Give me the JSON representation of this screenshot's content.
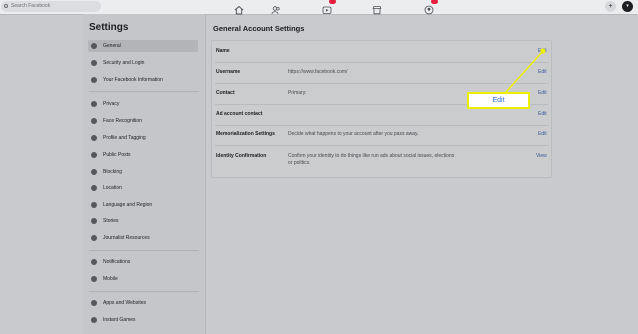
{
  "topbar": {
    "search_placeholder": "Search Facebook",
    "nav_icons": [
      "home-icon",
      "friends-icon",
      "watch-icon",
      "marketplace-icon",
      "groups-icon"
    ],
    "right_buttons": {
      "create": "+",
      "account": "▾"
    }
  },
  "sidebar": {
    "title": "Settings",
    "groups": [
      [
        {
          "label": "General",
          "icon": "gear-icon",
          "active": true
        },
        {
          "label": "Security and Login",
          "icon": "shield-icon"
        },
        {
          "label": "Your Facebook Information",
          "icon": "facebook-icon"
        }
      ],
      [
        {
          "label": "Privacy",
          "icon": "lock-icon"
        },
        {
          "label": "Face Recognition",
          "icon": "face-icon"
        },
        {
          "label": "Profile and Tagging",
          "icon": "tag-icon"
        },
        {
          "label": "Public Posts",
          "icon": "globe-icon"
        },
        {
          "label": "Blocking",
          "icon": "block-icon"
        },
        {
          "label": "Location",
          "icon": "location-icon"
        },
        {
          "label": "Language and Region",
          "icon": "language-icon"
        },
        {
          "label": "Stories",
          "icon": "stories-icon"
        },
        {
          "label": "Journalist Resources",
          "icon": "journalist-icon"
        }
      ],
      [
        {
          "label": "Notifications",
          "icon": "bell-icon"
        },
        {
          "label": "Mobile",
          "icon": "mobile-icon"
        }
      ],
      [
        {
          "label": "Apps and Websites",
          "icon": "apps-icon"
        },
        {
          "label": "Instant Games",
          "icon": "games-icon"
        }
      ]
    ]
  },
  "main": {
    "title": "General Account Settings",
    "rows": [
      {
        "label": "Name",
        "value": "",
        "action": "Edit"
      },
      {
        "label": "Username",
        "value": "https://www.facebook.com/",
        "action": "Edit"
      },
      {
        "label": "Contact",
        "value": "Primary:",
        "action": "Edit"
      },
      {
        "label": "Ad account contact",
        "value": "",
        "action": "Edit"
      },
      {
        "label": "Memorialization Settings",
        "value": "Decide what happens to your account after you pass away.",
        "action": "Edit"
      },
      {
        "label": "Identity Confirmation",
        "value": "Confirm your identity to do things like run ads about social issues, elections or politics.",
        "action": "View"
      }
    ]
  },
  "callout": {
    "label": "Edit",
    "color": "#ecf000"
  },
  "colors": {
    "accent": "#385898",
    "callout_text": "#2a6bd6",
    "badge": "#e41e3f"
  }
}
